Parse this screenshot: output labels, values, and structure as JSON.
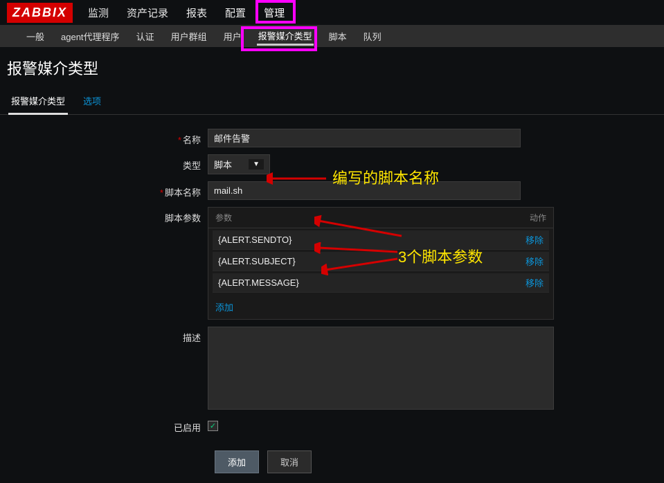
{
  "logo": "ZABBIX",
  "topnav": {
    "items": [
      {
        "label": "监测"
      },
      {
        "label": "资产记录"
      },
      {
        "label": "报表"
      },
      {
        "label": "配置"
      },
      {
        "label": "管理",
        "active": true
      }
    ]
  },
  "subnav": {
    "items": [
      {
        "label": "一般"
      },
      {
        "label": "agent代理程序"
      },
      {
        "label": "认证"
      },
      {
        "label": "用户群组"
      },
      {
        "label": "用户"
      },
      {
        "label": "报警媒介类型",
        "active": true
      },
      {
        "label": "脚本"
      },
      {
        "label": "队列"
      }
    ]
  },
  "page_title": "报警媒介类型",
  "tabs": [
    {
      "label": "报警媒介类型",
      "active": true
    },
    {
      "label": "选项",
      "link": true
    }
  ],
  "form": {
    "name_label": "名称",
    "name_value": "邮件告警",
    "type_label": "类型",
    "type_value": "脚本",
    "script_name_label": "脚本名称",
    "script_name_value": "mail.sh",
    "params_label": "脚本参数",
    "params_header_param": "参数",
    "params_header_action": "动作",
    "params": [
      {
        "value": "{ALERT.SENDTO}"
      },
      {
        "value": "{ALERT.SUBJECT}"
      },
      {
        "value": "{ALERT.MESSAGE}"
      }
    ],
    "remove_label": "移除",
    "add_param_label": "添加",
    "desc_label": "描述",
    "desc_value": "",
    "enabled_label": "已启用",
    "enabled_checked": true
  },
  "buttons": {
    "submit": "添加",
    "cancel": "取消"
  },
  "annotations": {
    "script_name": "编写的脚本名称",
    "params": "3个脚本参数"
  }
}
